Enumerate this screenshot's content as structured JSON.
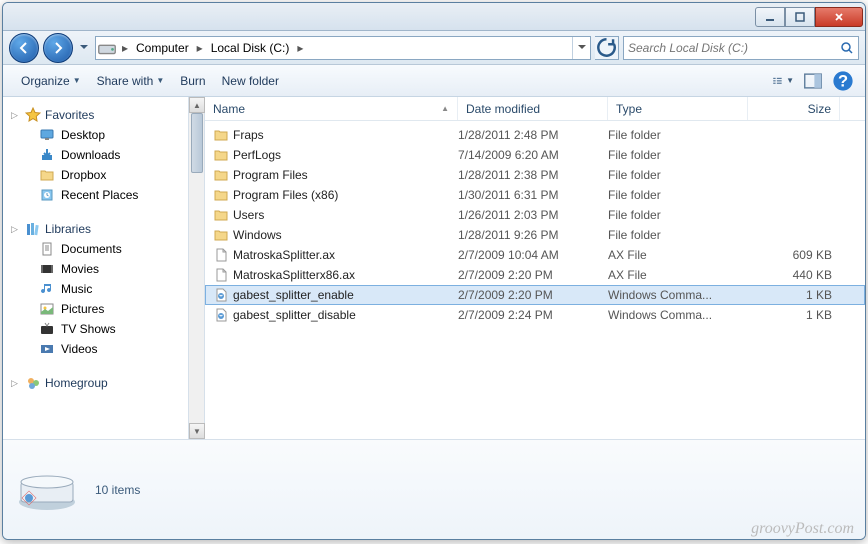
{
  "breadcrumbs": [
    "Computer",
    "Local Disk (C:)"
  ],
  "search": {
    "placeholder": "Search Local Disk (C:)"
  },
  "toolbar": {
    "organize": "Organize",
    "share": "Share with",
    "burn": "Burn",
    "newfolder": "New folder"
  },
  "sidebar": {
    "favorites": {
      "label": "Favorites",
      "items": [
        {
          "icon": "desktop",
          "label": "Desktop"
        },
        {
          "icon": "downloads",
          "label": "Downloads"
        },
        {
          "icon": "folder",
          "label": "Dropbox"
        },
        {
          "icon": "recent",
          "label": "Recent Places"
        }
      ]
    },
    "libraries": {
      "label": "Libraries",
      "items": [
        {
          "icon": "documents",
          "label": "Documents"
        },
        {
          "icon": "movies",
          "label": "Movies"
        },
        {
          "icon": "music",
          "label": "Music"
        },
        {
          "icon": "pictures",
          "label": "Pictures"
        },
        {
          "icon": "tv",
          "label": "TV Shows"
        },
        {
          "icon": "videos",
          "label": "Videos"
        }
      ]
    },
    "homegroup": {
      "label": "Homegroup"
    }
  },
  "columns": {
    "name": "Name",
    "date": "Date modified",
    "type": "Type",
    "size": "Size"
  },
  "files": [
    {
      "icon": "folder",
      "name": "Fraps",
      "date": "1/28/2011 2:48 PM",
      "type": "File folder",
      "size": ""
    },
    {
      "icon": "folder",
      "name": "PerfLogs",
      "date": "7/14/2009 6:20 AM",
      "type": "File folder",
      "size": ""
    },
    {
      "icon": "folder",
      "name": "Program Files",
      "date": "1/28/2011 2:38 PM",
      "type": "File folder",
      "size": ""
    },
    {
      "icon": "folder",
      "name": "Program Files (x86)",
      "date": "1/30/2011 6:31 PM",
      "type": "File folder",
      "size": ""
    },
    {
      "icon": "folder",
      "name": "Users",
      "date": "1/26/2011 2:03 PM",
      "type": "File folder",
      "size": ""
    },
    {
      "icon": "folder",
      "name": "Windows",
      "date": "1/28/2011 9:26 PM",
      "type": "File folder",
      "size": ""
    },
    {
      "icon": "file",
      "name": "MatroskaSplitter.ax",
      "date": "2/7/2009 10:04 AM",
      "type": "AX File",
      "size": "609 KB"
    },
    {
      "icon": "file",
      "name": "MatroskaSplitterx86.ax",
      "date": "2/7/2009 2:20 PM",
      "type": "AX File",
      "size": "440 KB"
    },
    {
      "icon": "cmd",
      "name": "gabest_splitter_enable",
      "date": "2/7/2009 2:20 PM",
      "type": "Windows Comma...",
      "size": "1 KB",
      "selected": true
    },
    {
      "icon": "cmd",
      "name": "gabest_splitter_disable",
      "date": "2/7/2009 2:24 PM",
      "type": "Windows Comma...",
      "size": "1 KB"
    }
  ],
  "details": {
    "count": "10 items"
  },
  "watermark": "groovyPost.com"
}
